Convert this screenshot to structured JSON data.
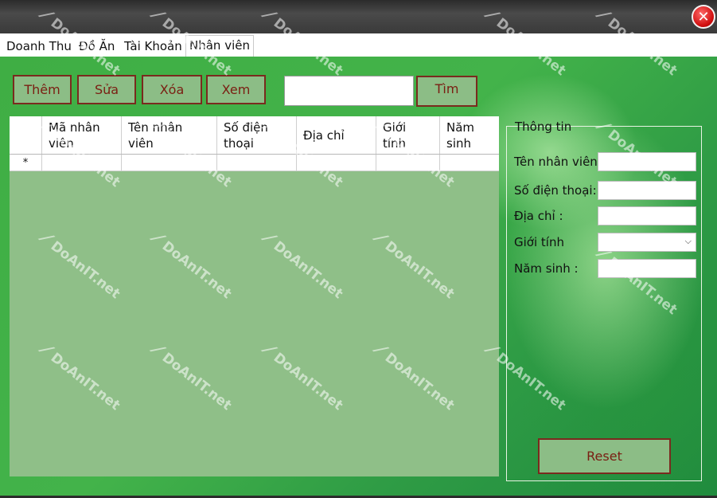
{
  "window": {
    "close_icon": "close-icon",
    "close_symbol": "✕"
  },
  "tabs": [
    {
      "label": "Doanh Thu",
      "active": false
    },
    {
      "label": "Đồ Ăn",
      "active": false
    },
    {
      "label": "Tài Khoản",
      "active": false
    },
    {
      "label": "Nhân viên",
      "active": true
    }
  ],
  "toolbar": {
    "add_label": "Thêm",
    "edit_label": "Sửa",
    "delete_label": "Xóa",
    "view_label": "Xem",
    "search_value": "",
    "search_button_label": "Tìm"
  },
  "grid": {
    "columns": [
      {
        "line1": "Mã nhân",
        "line2": "viên"
      },
      {
        "line1": "Tên nhân",
        "line2": "viên"
      },
      {
        "line1": "Số điện",
        "line2": "thoại"
      },
      {
        "line1": "Địa chỉ",
        "line2": ""
      },
      {
        "line1": "Giới",
        "line2": "tính"
      },
      {
        "line1": "Năm",
        "line2": "sinh"
      }
    ],
    "new_row_marker": "*"
  },
  "info_panel": {
    "title": "Thông tin",
    "fields": {
      "name_label": "Tên nhân viên:",
      "phone_label": "Số điện thoại:",
      "address_label": "Địa chỉ :",
      "gender_label": "Giới tính",
      "year_label": "Năm sinh :"
    },
    "values": {
      "name": "",
      "phone": "",
      "address": "",
      "gender": "",
      "year": ""
    },
    "reset_label": "Reset"
  },
  "watermark": {
    "text": "DoAnIT.net"
  },
  "colors": {
    "button_bg": "#8cbd86",
    "button_border": "#7a2a1e",
    "button_text": "#7a1e12",
    "background_green": "#3fae44",
    "grid_empty_area": "#8fbf88"
  }
}
